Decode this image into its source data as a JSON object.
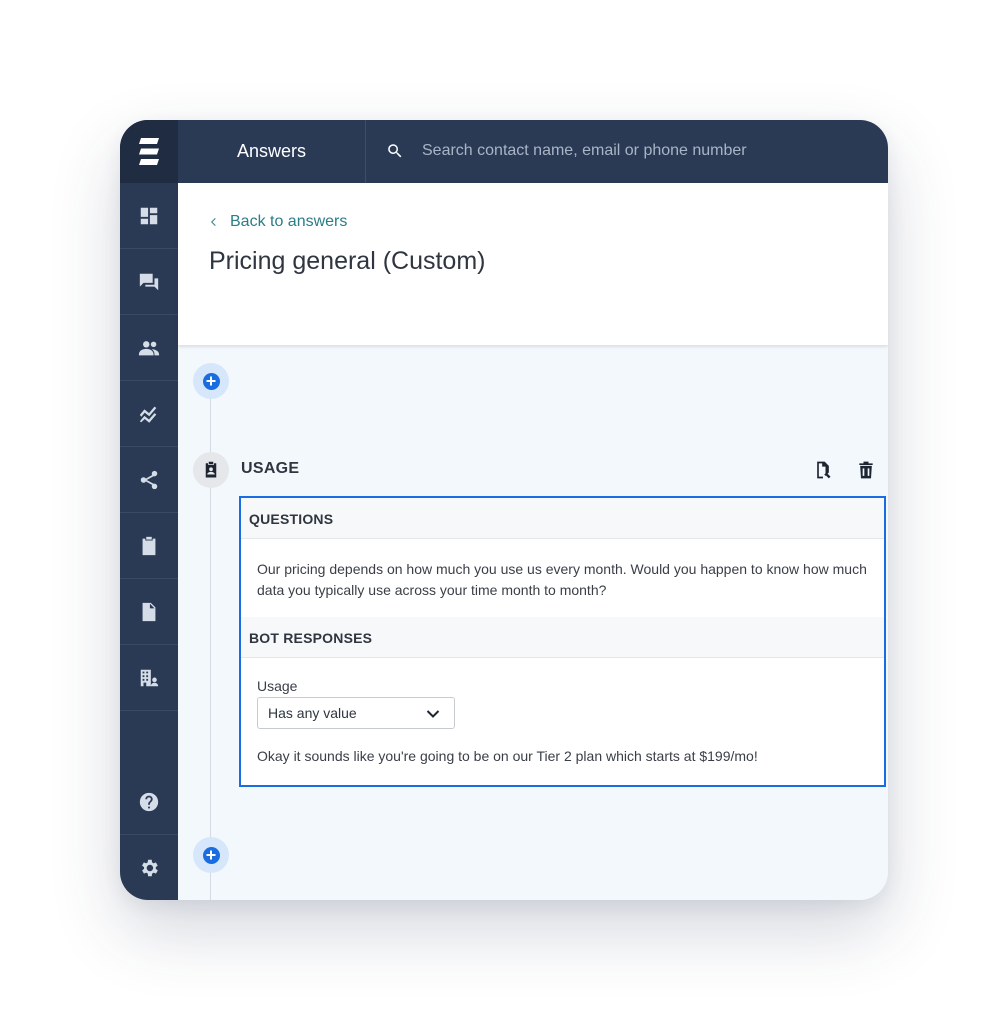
{
  "app": {
    "title": "Answers"
  },
  "search": {
    "placeholder": "Search contact name, email or phone number"
  },
  "sidebar": {
    "items": [
      {
        "icon": "dashboard-icon"
      },
      {
        "icon": "chat-icon"
      },
      {
        "icon": "contacts-icon"
      },
      {
        "icon": "analytics-icon"
      },
      {
        "icon": "share-icon"
      },
      {
        "icon": "clipboard-icon"
      },
      {
        "icon": "document-icon"
      },
      {
        "icon": "organization-icon"
      },
      {
        "icon": "help-icon"
      },
      {
        "icon": "settings-icon"
      }
    ]
  },
  "header": {
    "back_label": "Back to answers",
    "title": "Pricing general (Custom)"
  },
  "step": {
    "title": "USAGE",
    "questions_header": "QUESTIONS",
    "question": "Our pricing depends on how much you use us every month. Would you happen to know how much data you typically use across your time month to month?",
    "responses_header": "BOT RESPONSES",
    "field_label": "Usage",
    "select_value": "Has any value",
    "response": "Okay it sounds like you're going to be on our Tier 2 plan which starts at $199/mo!"
  },
  "colors": {
    "sidebar": "#2a3a55",
    "accent": "#1a6de0",
    "link": "#2b7d86",
    "content_bg": "#f3f8fd"
  }
}
